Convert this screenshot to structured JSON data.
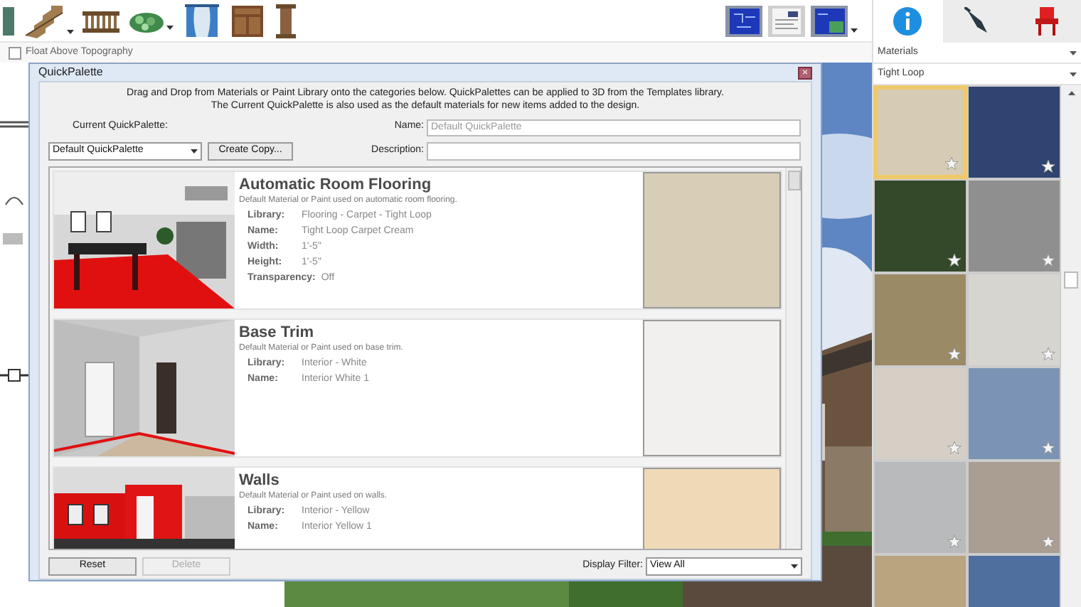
{
  "toolbar": {
    "float_checkbox": {
      "label": "Float Above Topography",
      "checked": false
    }
  },
  "side_panel": {
    "tabs": [
      {
        "kind": "info",
        "selected": true
      },
      {
        "kind": "pen",
        "selected": false
      },
      {
        "kind": "chair",
        "selected": false
      }
    ],
    "library_select": "Materials",
    "category_select": "Tight Loop",
    "swatches": [
      {
        "color": "#d6cbb4",
        "selected": true,
        "star": true
      },
      {
        "color": "#2f4470",
        "selected": false,
        "star": true
      },
      {
        "color": "#34482a",
        "selected": false,
        "star": true
      },
      {
        "color": "#8f8f8f",
        "selected": false,
        "star": true
      },
      {
        "color": "#9b8a66",
        "selected": false,
        "star": true
      },
      {
        "color": "#d7d5d0",
        "selected": false,
        "star": true
      },
      {
        "color": "#d6cfc5",
        "selected": false,
        "star": true
      },
      {
        "color": "#7b93b4",
        "selected": false,
        "star": true
      },
      {
        "color": "#b9babb",
        "selected": false,
        "star": true
      },
      {
        "color": "#aa9d92",
        "selected": false,
        "star": true
      },
      {
        "color": "#b8a580",
        "selected": false
      },
      {
        "color": "#4f6f9f",
        "selected": false
      }
    ]
  },
  "dialog": {
    "title": "QuickPalette",
    "close": "×",
    "instructions": [
      "Drag and Drop from Materials or Paint Library onto the categories below. QuickPalettes can be applied to 3D from the Templates library.",
      "The Current QuickPalette is also used as the default materials for new items added to the design."
    ],
    "current_label": "Current QuickPalette:",
    "current_value": "Default QuickPalette",
    "create_copy": "Create Copy...",
    "name_label": "Name:",
    "name_placeholder": "Default QuickPalette",
    "description_label": "Description:",
    "categories": [
      {
        "kind": "floor",
        "title": "Automatic Room Flooring",
        "description": "Default Material or Paint used on automatic room flooring.",
        "color": "#d8cdb6",
        "fields": [
          {
            "label": "Library:",
            "value": "Flooring - Carpet - Tight Loop"
          },
          {
            "label": "Name:",
            "value": "Tight Loop Carpet Cream"
          },
          {
            "label": "Width:",
            "value": "1'-5\""
          },
          {
            "label": "Height:",
            "value": "1'-5\""
          },
          {
            "label": "Transparency:",
            "value": "Off"
          }
        ]
      },
      {
        "kind": "trim",
        "title": "Base Trim",
        "description": "Default Material or Paint used on base trim.",
        "color": "#f1f0ee",
        "fields": [
          {
            "label": "Library:",
            "value": "Interior - White"
          },
          {
            "label": "Name:",
            "value": "Interior White 1"
          }
        ]
      },
      {
        "kind": "walls",
        "title": "Walls",
        "description": "Default Material or Paint used on walls.",
        "color": "#f0d9b6",
        "fields": [
          {
            "label": "Library:",
            "value": "Interior - Yellow"
          },
          {
            "label": "Name:",
            "value": "Interior Yellow 1"
          }
        ]
      }
    ],
    "reset": "Reset",
    "delete": {
      "label": "Delete",
      "disabled": true
    },
    "filter_label": "Display Filter:",
    "filter_value": "View All"
  }
}
